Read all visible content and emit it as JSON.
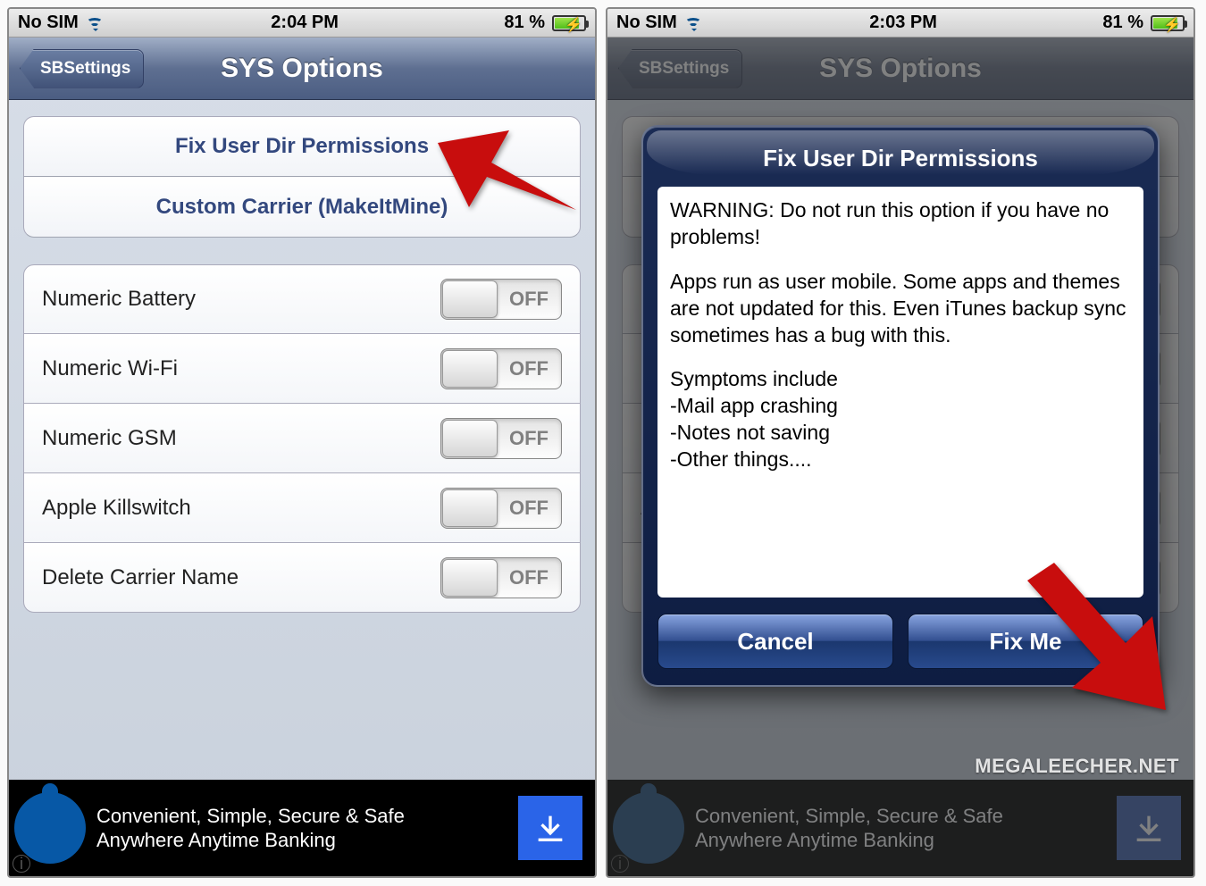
{
  "left": {
    "status": {
      "carrier": "No SIM",
      "time": "2:04 PM",
      "battery_pct": "81 %"
    },
    "nav": {
      "back": "SBSettings",
      "title": "SYS Options"
    },
    "actions": [
      {
        "label": "Fix User Dir Permissions"
      },
      {
        "label": "Custom Carrier (MakeItMine)"
      }
    ],
    "toggles": [
      {
        "label": "Numeric Battery",
        "state": "OFF"
      },
      {
        "label": "Numeric Wi-Fi",
        "state": "OFF"
      },
      {
        "label": "Numeric GSM",
        "state": "OFF"
      },
      {
        "label": "Apple Killswitch",
        "state": "OFF"
      },
      {
        "label": "Delete Carrier Name",
        "state": "OFF"
      }
    ],
    "ad": {
      "line1": "Convenient, Simple, Secure & Safe",
      "line2": "Anywhere Anytime Banking"
    }
  },
  "right": {
    "status": {
      "carrier": "No SIM",
      "time": "2:03 PM",
      "battery_pct": "81 %"
    },
    "nav": {
      "back": "SBSettings",
      "title": "SYS Options"
    },
    "modal": {
      "title": "Fix User Dir Permissions",
      "body_p1": "WARNING: Do not run this option if you have no problems!",
      "body_p2": "Apps run as user mobile. Some apps and themes are not updated for this. Even iTunes backup sync sometimes has a bug with this.",
      "body_p3": "Symptoms include",
      "body_l1": " -Mail app crashing",
      "body_l2": " -Notes not saving",
      "body_l3": " -Other things....",
      "cancel": "Cancel",
      "confirm": "Fix Me"
    },
    "ad": {
      "line1": "Convenient, Simple, Secure & Safe",
      "line2": "Anywhere Anytime Banking"
    },
    "watermark": "MEGALEECHER.NET"
  }
}
